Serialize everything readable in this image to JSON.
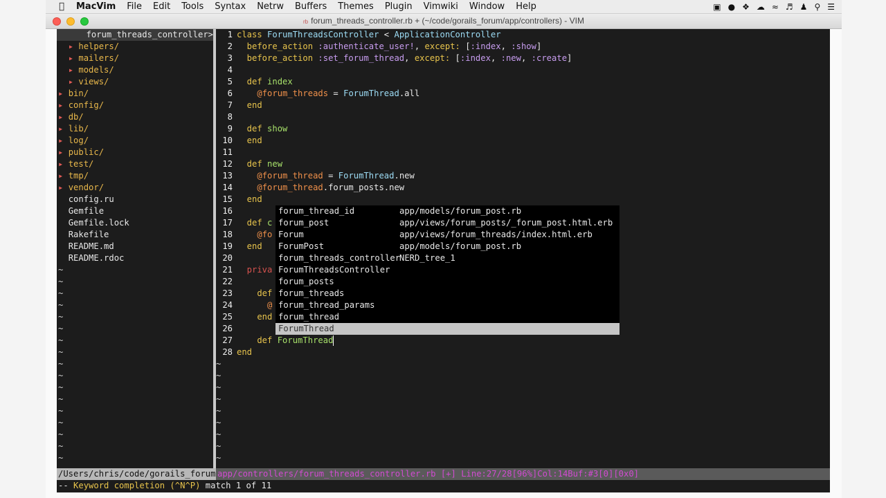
{
  "menubar": {
    "app": "MacVim",
    "items": [
      "File",
      "Edit",
      "Tools",
      "Syntax",
      "Netrw",
      "Buffers",
      "Themes",
      "Plugin",
      "Vimwiki",
      "Window",
      "Help"
    ]
  },
  "window": {
    "title": "forum_threads_controller.rb + (~/code/gorails_forum/app/controllers) - VIM"
  },
  "nerdtree": {
    "header": "forum_threads_controller>",
    "entries": [
      {
        "name": "helpers/",
        "type": "dir",
        "indent": 1
      },
      {
        "name": "mailers/",
        "type": "dir",
        "indent": 1
      },
      {
        "name": "models/",
        "type": "dir",
        "indent": 1
      },
      {
        "name": "views/",
        "type": "dir",
        "indent": 1
      },
      {
        "name": "bin/",
        "type": "dir",
        "indent": 0
      },
      {
        "name": "config/",
        "type": "dir",
        "indent": 0
      },
      {
        "name": "db/",
        "type": "dir",
        "indent": 0
      },
      {
        "name": "lib/",
        "type": "dir",
        "indent": 0
      },
      {
        "name": "log/",
        "type": "dir",
        "indent": 0
      },
      {
        "name": "public/",
        "type": "dir",
        "indent": 0
      },
      {
        "name": "test/",
        "type": "dir",
        "indent": 0
      },
      {
        "name": "tmp/",
        "type": "dir",
        "indent": 0
      },
      {
        "name": "vendor/",
        "type": "dir",
        "indent": 0
      },
      {
        "name": "config.ru",
        "type": "file",
        "indent": 0
      },
      {
        "name": "Gemfile",
        "type": "file",
        "indent": 0
      },
      {
        "name": "Gemfile.lock",
        "type": "file",
        "indent": 0
      },
      {
        "name": "Rakefile",
        "type": "file",
        "indent": 0
      },
      {
        "name": "README.md",
        "type": "file",
        "indent": 0
      },
      {
        "name": "README.rdoc",
        "type": "file",
        "indent": 0
      }
    ],
    "tilde_rows": 17
  },
  "editor": {
    "lines": [
      [
        {
          "t": "class ",
          "c": "kw"
        },
        {
          "t": "ForumThreadsController",
          "c": "cls"
        },
        {
          "t": " < ",
          "c": "code"
        },
        {
          "t": "ApplicationController",
          "c": "cls"
        }
      ],
      [
        {
          "t": "  before_action ",
          "c": "kw"
        },
        {
          "t": ":authenticate_user!",
          "c": "sym"
        },
        {
          "t": ", ",
          "c": "code"
        },
        {
          "t": "except:",
          "c": "kw"
        },
        {
          "t": " [",
          "c": "code"
        },
        {
          "t": ":index",
          "c": "sym"
        },
        {
          "t": ", ",
          "c": "code"
        },
        {
          "t": ":show",
          "c": "sym"
        },
        {
          "t": "]",
          "c": "code"
        }
      ],
      [
        {
          "t": "  before_action ",
          "c": "kw"
        },
        {
          "t": ":set_forum_thread",
          "c": "sym"
        },
        {
          "t": ", ",
          "c": "code"
        },
        {
          "t": "except:",
          "c": "kw"
        },
        {
          "t": " [",
          "c": "code"
        },
        {
          "t": ":index",
          "c": "sym"
        },
        {
          "t": ", ",
          "c": "code"
        },
        {
          "t": ":new",
          "c": "sym"
        },
        {
          "t": ", ",
          "c": "code"
        },
        {
          "t": ":create",
          "c": "sym"
        },
        {
          "t": "]",
          "c": "code"
        }
      ],
      [],
      [
        {
          "t": "  def ",
          "c": "kw"
        },
        {
          "t": "index",
          "c": "meth"
        }
      ],
      [
        {
          "t": "    ",
          "c": "code"
        },
        {
          "t": "@forum_threads",
          "c": "ivar"
        },
        {
          "t": " = ",
          "c": "code"
        },
        {
          "t": "ForumThread",
          "c": "cls"
        },
        {
          "t": ".all",
          "c": "code"
        }
      ],
      [
        {
          "t": "  end",
          "c": "kw"
        }
      ],
      [],
      [
        {
          "t": "  def ",
          "c": "kw"
        },
        {
          "t": "show",
          "c": "meth"
        }
      ],
      [
        {
          "t": "  end",
          "c": "kw"
        }
      ],
      [],
      [
        {
          "t": "  def ",
          "c": "kw"
        },
        {
          "t": "new",
          "c": "meth"
        }
      ],
      [
        {
          "t": "    ",
          "c": "code"
        },
        {
          "t": "@forum_thread",
          "c": "ivar"
        },
        {
          "t": " = ",
          "c": "code"
        },
        {
          "t": "ForumThread",
          "c": "cls"
        },
        {
          "t": ".new",
          "c": "code"
        }
      ],
      [
        {
          "t": "    ",
          "c": "code"
        },
        {
          "t": "@forum_thread",
          "c": "ivar"
        },
        {
          "t": ".forum_posts.new",
          "c": "code"
        }
      ],
      [
        {
          "t": "  end",
          "c": "kw"
        }
      ],
      [],
      [
        {
          "t": "  def ",
          "c": "kw"
        },
        {
          "t": "c",
          "c": "meth"
        }
      ],
      [
        {
          "t": "    ",
          "c": "code"
        },
        {
          "t": "@fo",
          "c": "ivar"
        }
      ],
      [
        {
          "t": "  end",
          "c": "kw"
        }
      ],
      [],
      [
        {
          "t": "  priva",
          "c": "kwr"
        }
      ],
      [],
      [
        {
          "t": "    def ",
          "c": "kw"
        }
      ],
      [
        {
          "t": "      @",
          "c": "ivar"
        }
      ],
      [
        {
          "t": "    end",
          "c": "kw"
        }
      ],
      [],
      [
        {
          "t": "    def ",
          "c": "kw"
        },
        {
          "t": "ForumThread",
          "c": "meth"
        }
      ],
      [
        {
          "t": "end",
          "c": "kw"
        }
      ]
    ],
    "tilde_rows": 9
  },
  "popup": {
    "items": [
      {
        "word": "forum_thread_id",
        "kind": "app/models/forum_post.rb"
      },
      {
        "word": "forum_post",
        "kind": "app/views/forum_posts/_forum_post.html.erb"
      },
      {
        "word": "Forum",
        "kind": "app/views/forum_threads/index.html.erb"
      },
      {
        "word": "ForumPost",
        "kind": "app/models/forum_post.rb"
      },
      {
        "word": "forum_threads_controller",
        "kind": "NERD_tree_1"
      },
      {
        "word": "ForumThreadsController",
        "kind": ""
      },
      {
        "word": "forum_posts",
        "kind": ""
      },
      {
        "word": "forum_threads",
        "kind": ""
      },
      {
        "word": "forum_thread_params",
        "kind": ""
      },
      {
        "word": "forum_thread",
        "kind": ""
      },
      {
        "word": "ForumThread",
        "kind": "",
        "selected": true
      }
    ]
  },
  "statusline": {
    "left": "/Users/chris/code/gorails_forum",
    "right": "app/controllers/forum_threads_controller.rb [+] Line:27/28[96%]Col:14Buf:#3[0][0x0]"
  },
  "cmdline": {
    "prefix": "-- ",
    "mode": "Keyword completion (^N^P)",
    "match": " match 1 of 11"
  }
}
